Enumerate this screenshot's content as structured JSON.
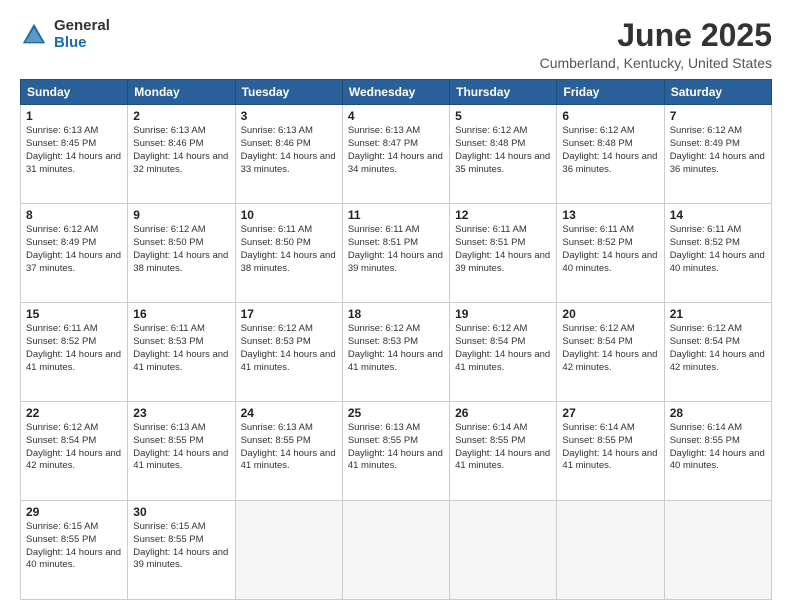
{
  "logo": {
    "general": "General",
    "blue": "Blue"
  },
  "title": "June 2025",
  "subtitle": "Cumberland, Kentucky, United States",
  "days_header": [
    "Sunday",
    "Monday",
    "Tuesday",
    "Wednesday",
    "Thursday",
    "Friday",
    "Saturday"
  ],
  "weeks": [
    [
      {
        "day": "1",
        "sunrise": "6:13 AM",
        "sunset": "8:45 PM",
        "daylight": "14 hours and 31 minutes."
      },
      {
        "day": "2",
        "sunrise": "6:13 AM",
        "sunset": "8:46 PM",
        "daylight": "14 hours and 32 minutes."
      },
      {
        "day": "3",
        "sunrise": "6:13 AM",
        "sunset": "8:46 PM",
        "daylight": "14 hours and 33 minutes."
      },
      {
        "day": "4",
        "sunrise": "6:13 AM",
        "sunset": "8:47 PM",
        "daylight": "14 hours and 34 minutes."
      },
      {
        "day": "5",
        "sunrise": "6:12 AM",
        "sunset": "8:48 PM",
        "daylight": "14 hours and 35 minutes."
      },
      {
        "day": "6",
        "sunrise": "6:12 AM",
        "sunset": "8:48 PM",
        "daylight": "14 hours and 36 minutes."
      },
      {
        "day": "7",
        "sunrise": "6:12 AM",
        "sunset": "8:49 PM",
        "daylight": "14 hours and 36 minutes."
      }
    ],
    [
      {
        "day": "8",
        "sunrise": "6:12 AM",
        "sunset": "8:49 PM",
        "daylight": "14 hours and 37 minutes."
      },
      {
        "day": "9",
        "sunrise": "6:12 AM",
        "sunset": "8:50 PM",
        "daylight": "14 hours and 38 minutes."
      },
      {
        "day": "10",
        "sunrise": "6:11 AM",
        "sunset": "8:50 PM",
        "daylight": "14 hours and 38 minutes."
      },
      {
        "day": "11",
        "sunrise": "6:11 AM",
        "sunset": "8:51 PM",
        "daylight": "14 hours and 39 minutes."
      },
      {
        "day": "12",
        "sunrise": "6:11 AM",
        "sunset": "8:51 PM",
        "daylight": "14 hours and 39 minutes."
      },
      {
        "day": "13",
        "sunrise": "6:11 AM",
        "sunset": "8:52 PM",
        "daylight": "14 hours and 40 minutes."
      },
      {
        "day": "14",
        "sunrise": "6:11 AM",
        "sunset": "8:52 PM",
        "daylight": "14 hours and 40 minutes."
      }
    ],
    [
      {
        "day": "15",
        "sunrise": "6:11 AM",
        "sunset": "8:52 PM",
        "daylight": "14 hours and 41 minutes."
      },
      {
        "day": "16",
        "sunrise": "6:11 AM",
        "sunset": "8:53 PM",
        "daylight": "14 hours and 41 minutes."
      },
      {
        "day": "17",
        "sunrise": "6:12 AM",
        "sunset": "8:53 PM",
        "daylight": "14 hours and 41 minutes."
      },
      {
        "day": "18",
        "sunrise": "6:12 AM",
        "sunset": "8:53 PM",
        "daylight": "14 hours and 41 minutes."
      },
      {
        "day": "19",
        "sunrise": "6:12 AM",
        "sunset": "8:54 PM",
        "daylight": "14 hours and 41 minutes."
      },
      {
        "day": "20",
        "sunrise": "6:12 AM",
        "sunset": "8:54 PM",
        "daylight": "14 hours and 42 minutes."
      },
      {
        "day": "21",
        "sunrise": "6:12 AM",
        "sunset": "8:54 PM",
        "daylight": "14 hours and 42 minutes."
      }
    ],
    [
      {
        "day": "22",
        "sunrise": "6:12 AM",
        "sunset": "8:54 PM",
        "daylight": "14 hours and 42 minutes."
      },
      {
        "day": "23",
        "sunrise": "6:13 AM",
        "sunset": "8:55 PM",
        "daylight": "14 hours and 41 minutes."
      },
      {
        "day": "24",
        "sunrise": "6:13 AM",
        "sunset": "8:55 PM",
        "daylight": "14 hours and 41 minutes."
      },
      {
        "day": "25",
        "sunrise": "6:13 AM",
        "sunset": "8:55 PM",
        "daylight": "14 hours and 41 minutes."
      },
      {
        "day": "26",
        "sunrise": "6:14 AM",
        "sunset": "8:55 PM",
        "daylight": "14 hours and 41 minutes."
      },
      {
        "day": "27",
        "sunrise": "6:14 AM",
        "sunset": "8:55 PM",
        "daylight": "14 hours and 41 minutes."
      },
      {
        "day": "28",
        "sunrise": "6:14 AM",
        "sunset": "8:55 PM",
        "daylight": "14 hours and 40 minutes."
      }
    ],
    [
      {
        "day": "29",
        "sunrise": "6:15 AM",
        "sunset": "8:55 PM",
        "daylight": "14 hours and 40 minutes."
      },
      {
        "day": "30",
        "sunrise": "6:15 AM",
        "sunset": "8:55 PM",
        "daylight": "14 hours and 39 minutes."
      },
      null,
      null,
      null,
      null,
      null
    ]
  ]
}
